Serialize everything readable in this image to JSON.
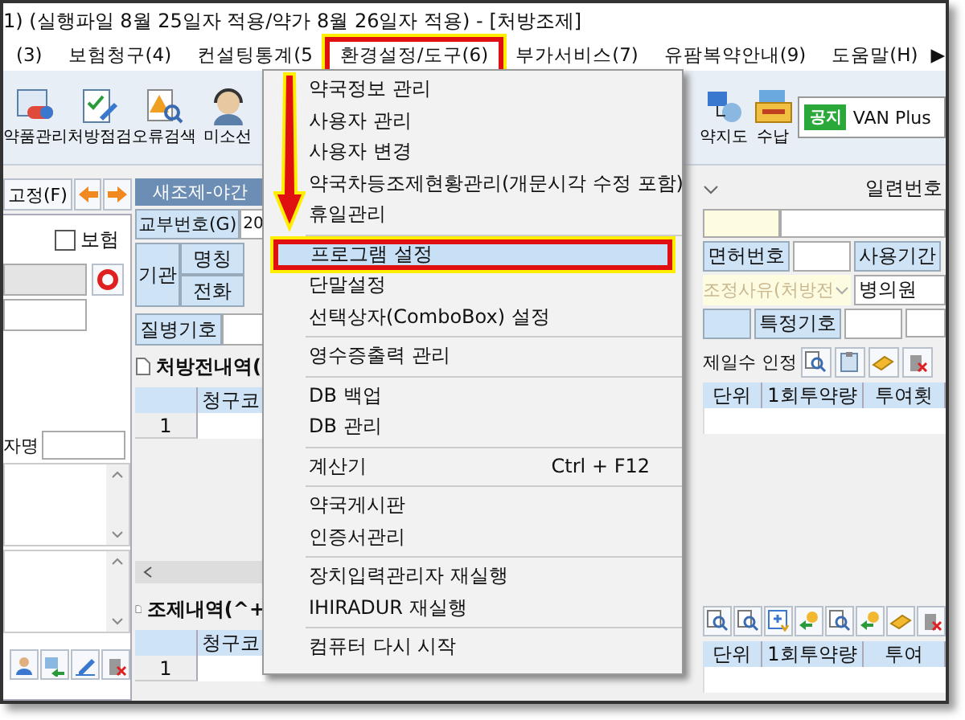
{
  "window": {
    "title": "1) (실행파일 8월 25일자 적용/약가 8월 26일자 적용) - [처방조제]"
  },
  "menu_bar": [
    {
      "label": "(3)",
      "selected": false
    },
    {
      "label": "보험청구(4)",
      "selected": false
    },
    {
      "label": "컨설팅통계(5",
      "selected": false
    },
    {
      "label": "환경설정/도구(6)",
      "selected": true
    },
    {
      "label": "부가서비스(7)",
      "selected": false
    },
    {
      "label": "유팜복약안내(9)",
      "selected": false
    },
    {
      "label": "도움말(H)",
      "selected": false
    }
  ],
  "menu_overflow": "▶",
  "toolbar": [
    {
      "label": "약품관리",
      "kind": "pill"
    },
    {
      "label": "처방점검",
      "kind": "check"
    },
    {
      "label": "오류검색",
      "kind": "warning"
    },
    {
      "label": "미소선",
      "kind": "headset"
    },
    {
      "label": "약지도",
      "kind": "network"
    },
    {
      "label": "수납",
      "kind": "cash"
    }
  ],
  "notice": {
    "badge": "공지",
    "text": "VAN Plus"
  },
  "left_panel": {
    "fix_button": "고정(F)",
    "insurance": {
      "label": "보험",
      "checked": false
    },
    "name_label": "자명"
  },
  "prescription": {
    "tab": "새조제-야간",
    "issue_no_label": "교부번호(G)",
    "issue_no_value": "20",
    "institution_label": "기관",
    "name_label": "명칭",
    "phone_label": "전화",
    "disease_label": "질병기호",
    "section_title": "처방전내역(",
    "serial_label": "일련번호",
    "license_label": "면허번호",
    "period_label": "사용기간",
    "reason_placeholder": "조정사유(처방전",
    "hospital_value": "병의원",
    "special_label": "특정기호",
    "days_label": "제일수 인정",
    "grid": {
      "columns": [
        "청구코",
        "단위",
        "1회투약량",
        "투여횟"
      ],
      "rows": [
        "1"
      ]
    }
  },
  "dispense": {
    "section_title": "조제내역(^+",
    "grid": {
      "columns": [
        "청구코",
        "단위",
        "1회투약량",
        "투여"
      ],
      "rows": [
        "1"
      ]
    }
  },
  "dropdown_menu": [
    {
      "kind": "item",
      "label": "약국정보 관리",
      "selected": false
    },
    {
      "kind": "item",
      "label": "사용자 관리",
      "selected": false
    },
    {
      "kind": "item",
      "label": "사용자 변경",
      "selected": false
    },
    {
      "kind": "item",
      "label": "약국차등조제현황관리(개문시각 수정 포함)",
      "selected": false
    },
    {
      "kind": "item",
      "label": "휴일관리",
      "selected": false
    },
    {
      "kind": "separator"
    },
    {
      "kind": "item",
      "label": "프로그램 설정",
      "selected": true
    },
    {
      "kind": "item",
      "label": "단말설정",
      "selected": false
    },
    {
      "kind": "item",
      "label": "선택상자(ComboBox) 설정",
      "selected": false
    },
    {
      "kind": "separator"
    },
    {
      "kind": "item",
      "label": "영수증출력 관리",
      "selected": false
    },
    {
      "kind": "separator"
    },
    {
      "kind": "item",
      "label": "DB 백업",
      "selected": false
    },
    {
      "kind": "item",
      "label": "DB 관리",
      "selected": false
    },
    {
      "kind": "separator"
    },
    {
      "kind": "item",
      "label": "계산기",
      "shortcut": "Ctrl + F12",
      "selected": false
    },
    {
      "kind": "separator"
    },
    {
      "kind": "item",
      "label": "약국게시판",
      "selected": false
    },
    {
      "kind": "item",
      "label": "인증서관리",
      "selected": false
    },
    {
      "kind": "separator"
    },
    {
      "kind": "item",
      "label": "장치입력관리자 재실행",
      "selected": false
    },
    {
      "kind": "item",
      "label": "IHIRADUR 재실행",
      "selected": false
    },
    {
      "kind": "separator"
    },
    {
      "kind": "item",
      "label": "컴퓨터 다시 시작",
      "selected": false
    }
  ]
}
